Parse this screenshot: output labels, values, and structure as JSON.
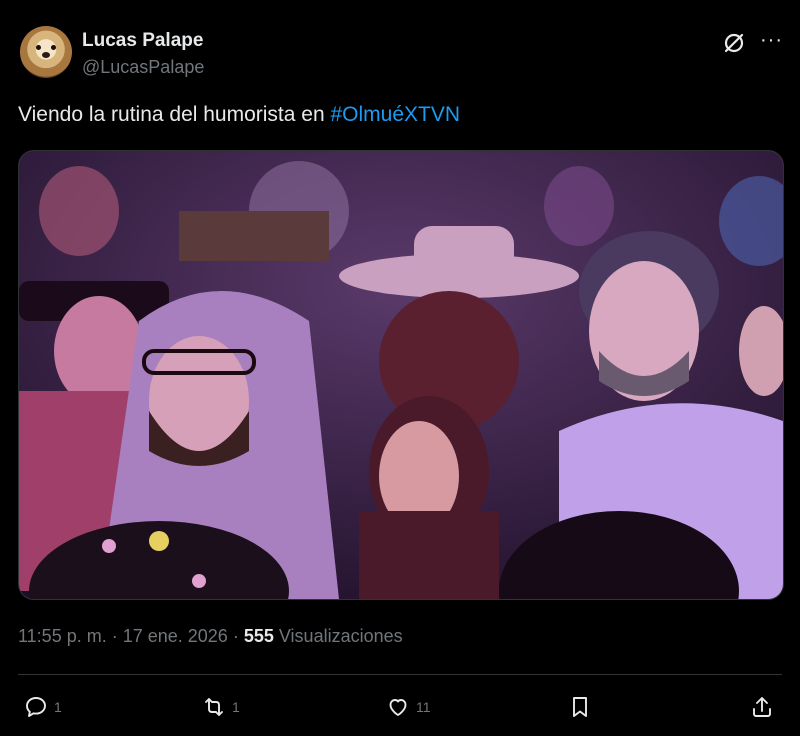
{
  "author": {
    "name": "Lucas Palape",
    "handle": "@LucasPalape"
  },
  "tweet": {
    "text_prefix": "Viendo la rutina del humorista en ",
    "hashtag": "#OlmuéXTVN"
  },
  "meta": {
    "time": "11:55 p. m.",
    "separator1": " · ",
    "date": "17 ene. 2026",
    "separator2": " · ",
    "views_count": "555",
    "views_label": " Visualizaciones"
  },
  "actions": {
    "replies": "1",
    "reposts": "1",
    "likes": "11"
  },
  "colors": {
    "background": "#000000",
    "text": "#e7e9ea",
    "secondary": "#71767b",
    "link": "#1d9bf0",
    "border": "#2f3336"
  },
  "icons": [
    "grok-icon",
    "more-icon",
    "reply-icon",
    "repost-icon",
    "like-icon",
    "bookmark-icon",
    "share-icon"
  ]
}
